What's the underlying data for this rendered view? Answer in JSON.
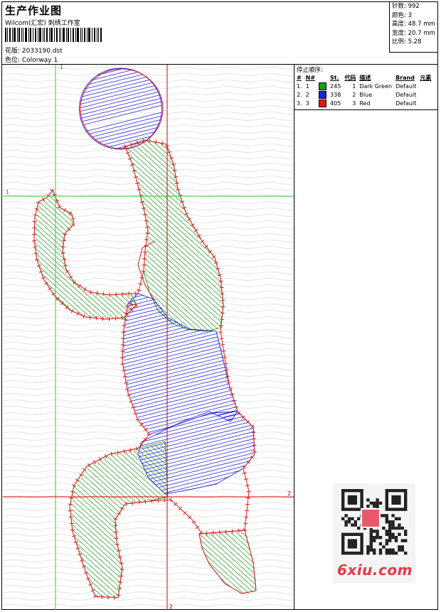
{
  "header": {
    "title": "生产作业图",
    "studio": "Wilcom(汇宏) 刺绣工作室",
    "design_label": "花版: 2033190.dst",
    "colorway_label": "色位: Colorway 1"
  },
  "stats": {
    "stitches": "针数: 992",
    "colors": "颜色: 3",
    "height": "高度: 48.7 mm",
    "width": "宽度: 20.7 mm",
    "scale": "比例: 5.28"
  },
  "guides": {
    "v1": "1",
    "h1": "1",
    "h2": "2",
    "v2": "2"
  },
  "stop_sequence": {
    "title": "停止顺序:",
    "headers": [
      "#",
      "N#",
      "St.",
      "代码",
      "描述",
      "Brand",
      "元素"
    ],
    "rows": [
      {
        "idx": "1.",
        "n": "1",
        "color": "#1a9e1a",
        "st": "245",
        "code": "1",
        "desc": "Dark Green",
        "brand": "Default"
      },
      {
        "idx": "2.",
        "n": "2",
        "color": "#2222dd",
        "st": "338",
        "code": "2",
        "desc": "Blue",
        "brand": "Default"
      },
      {
        "idx": "3.",
        "n": "3",
        "color": "#e01818",
        "st": "405",
        "code": "3",
        "desc": "Red",
        "brand": "Default"
      }
    ]
  },
  "palette": {
    "green": "#1a9e1a",
    "blue": "#2222dd",
    "red": "#e01818",
    "guide_green": "#33cc33",
    "guide_red": "#dd0000"
  },
  "watermark": {
    "text": "6xiu.com",
    "icon": "qr-code-icon"
  }
}
